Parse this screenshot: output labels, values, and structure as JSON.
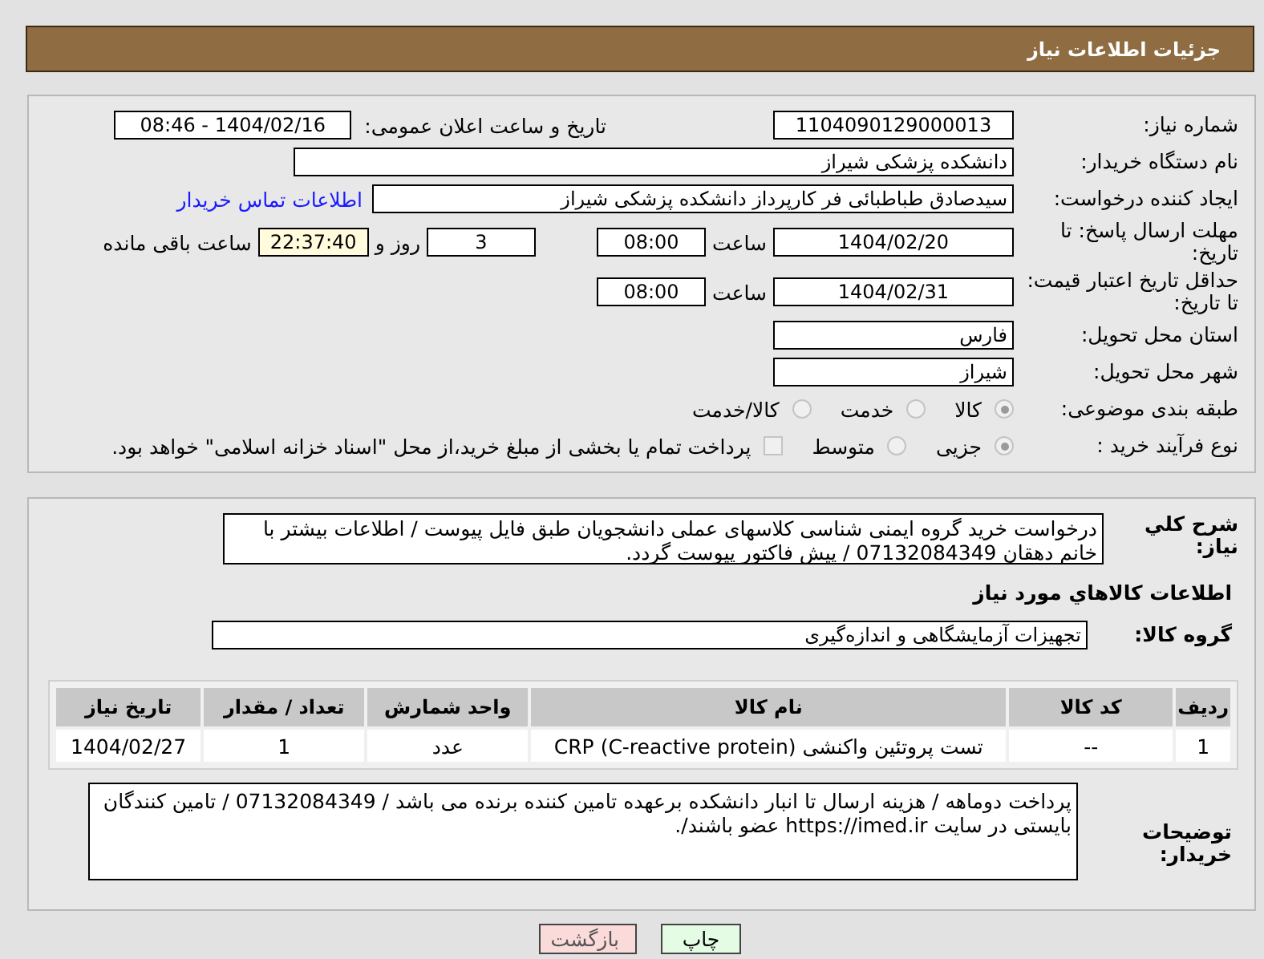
{
  "page_title": "جزئیات اطلاعات نیاز",
  "need_number": {
    "label": "شماره نیاز:",
    "value": "1104090129000013"
  },
  "announce": {
    "label": "تاریخ و ساعت اعلان عمومی:",
    "value": "1404/02/16 - 08:46"
  },
  "buyer_org": {
    "label": "نام دستگاه خریدار:",
    "value": "دانشکده پزشکی شیراز"
  },
  "requester": {
    "label": "ایجاد کننده درخواست:",
    "value": "سیدصادق طباطبائی فر کارپرداز دانشکده پزشکی شیراز",
    "link": "اطلاعات تماس خریدار"
  },
  "reply_deadline": {
    "label": "مهلت ارسال پاسخ: تا تاریخ:",
    "date": "1404/02/20",
    "time_label": "ساعت",
    "time": "08:00",
    "days": "3",
    "days_label": "روز و",
    "remaining": "22:37:40",
    "remaining_label": "ساعت باقی مانده"
  },
  "price_validity": {
    "label": "حداقل تاریخ اعتبار قیمت: تا تاریخ:",
    "date": "1404/02/31",
    "time_label": "ساعت",
    "time": "08:00"
  },
  "province": {
    "label": "استان محل تحویل:",
    "value": "فارس"
  },
  "city": {
    "label": "شهر محل تحویل:",
    "value": "شیراز"
  },
  "category": {
    "label": "طبقه بندی موضوعی:",
    "options": [
      {
        "label": "کالا",
        "selected": true
      },
      {
        "label": "خدمت",
        "selected": false
      },
      {
        "label": "کالا/خدمت",
        "selected": false
      }
    ]
  },
  "process": {
    "label": "نوع فرآیند خرید :",
    "options": [
      {
        "label": "جزیی",
        "selected": true
      },
      {
        "label": "متوسط",
        "selected": false
      }
    ],
    "treasury": {
      "label": "پرداخت تمام یا بخشی از مبلغ خرید،از محل \"اسناد خزانه اسلامی\" خواهد بود.",
      "checked": false
    }
  },
  "description": {
    "label": "شرح کلي نیاز:",
    "value": "درخواست خرید گروه ایمنی شناسی کلاسهای عملی دانشجویان طبق فایل پیوست / اطلاعات بیشتر با خانم دهقان 07132084349 / پیش فاکتور پیوست گردد."
  },
  "items_heading": "اطلاعات کالاهاي مورد نیاز",
  "goods_group": {
    "label": "گروه کالا:",
    "value": "تجهیزات آزمایشگاهی و اندازه‌گیری"
  },
  "table": {
    "columns": [
      "ردیف",
      "کد کالا",
      "نام کالا",
      "واحد شمارش",
      "تعداد / مقدار",
      "تاریخ نیاز"
    ],
    "rows": [
      [
        "1",
        "--",
        "تست پروتئین واکنشی (CRP (C-reactive protein",
        "عدد",
        "1",
        "1404/02/27"
      ]
    ]
  },
  "buyer_notes": {
    "label": "توضیحات خریدار:",
    "value": "پرداخت دوماهه / هزینه ارسال تا انبار دانشکده برعهده تامین کننده برنده می باشد / 07132084349 / تامین کنندگان بایستی در سایت https://imed.ir عضو باشند/."
  },
  "buttons": [
    {
      "label": "چاپ",
      "kind": "print"
    },
    {
      "label": "بازگشت",
      "kind": "back"
    }
  ]
}
